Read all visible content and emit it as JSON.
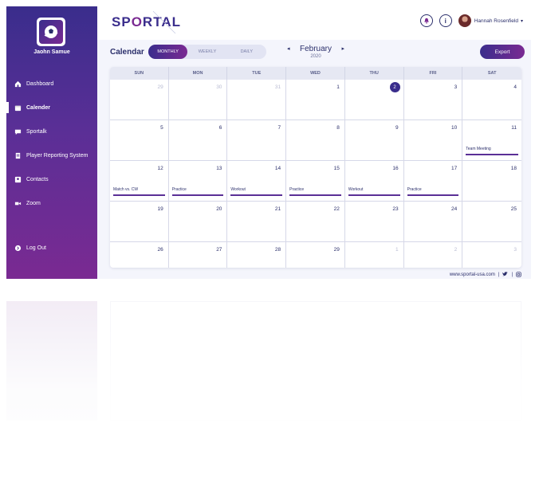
{
  "sidebar": {
    "user_name": "Jaohn Samue",
    "items": [
      {
        "label": "Dashboard",
        "icon": "home-icon"
      },
      {
        "label": "Calender",
        "icon": "calendar-icon"
      },
      {
        "label": "Sportalk",
        "icon": "chat-icon"
      },
      {
        "label": "Player Reporting System",
        "icon": "clipboard-icon"
      },
      {
        "label": "Contacts",
        "icon": "contacts-icon"
      },
      {
        "label": "Zoom",
        "icon": "video-icon"
      }
    ],
    "logout_label": "Log Out"
  },
  "header": {
    "brand_part1": "SP",
    "brand_o": "O",
    "brand_part2": "RTAL",
    "user_name": "Hannah Rosenfield",
    "info_glyph": "i"
  },
  "toolbar": {
    "title": "Calendar",
    "views": [
      "MONTHLY",
      "WEEKLY",
      "DAILY"
    ],
    "active_view": "MONTHLY",
    "month": "February",
    "year": "2020",
    "export_label": "Export"
  },
  "calendar": {
    "weekdays": [
      "SUN",
      "MON",
      "TUE",
      "WED",
      "THU",
      "FRI",
      "SAT"
    ],
    "days": [
      {
        "n": "29",
        "muted": true
      },
      {
        "n": "30",
        "muted": true
      },
      {
        "n": "31",
        "muted": true
      },
      {
        "n": "1"
      },
      {
        "n": "2",
        "today": true
      },
      {
        "n": "3"
      },
      {
        "n": "4"
      },
      {
        "n": "5"
      },
      {
        "n": "6"
      },
      {
        "n": "7"
      },
      {
        "n": "8"
      },
      {
        "n": "9"
      },
      {
        "n": "10"
      },
      {
        "n": "11",
        "event": "Team Meeting"
      },
      {
        "n": "12",
        "event": "Match vs. CW"
      },
      {
        "n": "13",
        "event": "Practice"
      },
      {
        "n": "14",
        "event": "Workout"
      },
      {
        "n": "15",
        "event": "Practice"
      },
      {
        "n": "16",
        "event": "Workout"
      },
      {
        "n": "17",
        "event": "Practice"
      },
      {
        "n": "18"
      },
      {
        "n": "19"
      },
      {
        "n": "20"
      },
      {
        "n": "21"
      },
      {
        "n": "22"
      },
      {
        "n": "23"
      },
      {
        "n": "24"
      },
      {
        "n": "25"
      },
      {
        "n": "26"
      },
      {
        "n": "27"
      },
      {
        "n": "28"
      },
      {
        "n": "29"
      },
      {
        "n": "1",
        "muted": true
      },
      {
        "n": "2",
        "muted": true
      },
      {
        "n": "3",
        "muted": true
      }
    ]
  },
  "footer": {
    "website": "www.sportal-usa.com",
    "separator": "|"
  },
  "colors": {
    "primary": "#3a2d8c",
    "accent": "#7a2a92",
    "text": "#2b2f6b"
  }
}
